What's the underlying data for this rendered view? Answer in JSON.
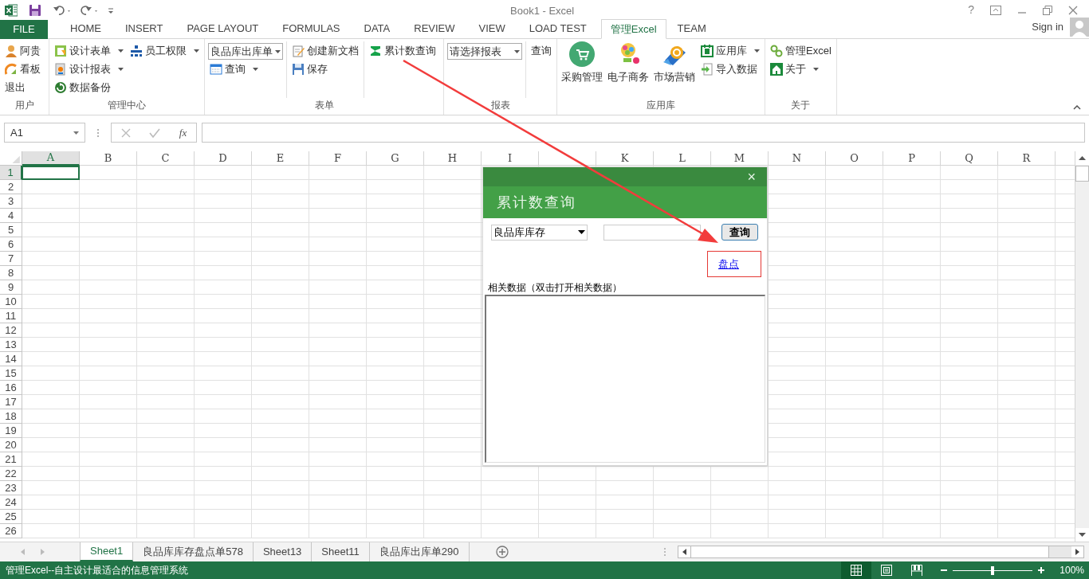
{
  "window": {
    "title": "Book1 - Excel",
    "help": "?"
  },
  "tabs": [
    {
      "label": "FILE",
      "kind": "file"
    },
    {
      "label": "HOME",
      "kind": "tab",
      "selected": false
    },
    {
      "label": "INSERT",
      "kind": "tab",
      "selected": false
    },
    {
      "label": "PAGE LAYOUT",
      "kind": "tab",
      "selected": false
    },
    {
      "label": "FORMULAS",
      "kind": "tab",
      "selected": false
    },
    {
      "label": "DATA",
      "kind": "tab",
      "selected": false
    },
    {
      "label": "REVIEW",
      "kind": "tab",
      "selected": false
    },
    {
      "label": "VIEW",
      "kind": "tab",
      "selected": false
    },
    {
      "label": "LOAD TEST",
      "kind": "tab",
      "selected": false
    },
    {
      "label": "管理Excel",
      "kind": "tab",
      "selected": true
    },
    {
      "label": "TEAM",
      "kind": "tab",
      "selected": false
    }
  ],
  "account": {
    "sign_in": "Sign in"
  },
  "ribbon": {
    "groups": [
      {
        "label": "用户",
        "columns": [
          [
            {
              "kind": "button",
              "label": "阿贵",
              "dropdown": false
            },
            {
              "kind": "button",
              "label": "看板",
              "dropdown": false
            },
            {
              "kind": "button",
              "label": "退出",
              "dropdown": false
            }
          ]
        ]
      },
      {
        "label": "管理中心",
        "columns": [
          [
            {
              "kind": "button",
              "label": "设计表单",
              "dropdown": true
            },
            {
              "kind": "button",
              "label": "设计报表",
              "dropdown": true
            },
            {
              "kind": "button",
              "label": "数据备份",
              "dropdown": false
            }
          ],
          [
            {
              "kind": "button",
              "label": "员工权限",
              "dropdown": true
            }
          ]
        ]
      },
      {
        "label": "表单",
        "columns": [
          [
            {
              "kind": "combo",
              "value": "良品库出库单"
            },
            {
              "kind": "button",
              "label": "查询",
              "dropdown": true
            }
          ],
          [
            {
              "kind": "button",
              "label": "创建新文档",
              "dropdown": false
            },
            {
              "kind": "button",
              "label": "保存",
              "dropdown": false
            }
          ],
          [
            {
              "kind": "button",
              "label": "累计数查询",
              "dropdown": false
            }
          ]
        ]
      },
      {
        "label": "报表",
        "columns": [
          [
            {
              "kind": "combo",
              "value": "请选择报表"
            }
          ],
          [
            {
              "kind": "button",
              "label": "查询",
              "dropdown": false
            }
          ]
        ]
      },
      {
        "label": "应用库",
        "columns": [
          [
            {
              "kind": "large",
              "label": "采购管理"
            }
          ],
          [
            {
              "kind": "large",
              "label": "电子商务"
            }
          ],
          [
            {
              "kind": "large",
              "label": "市场营销"
            }
          ],
          [
            {
              "kind": "button",
              "label": "应用库",
              "dropdown": true
            },
            {
              "kind": "button",
              "label": "导入数据",
              "dropdown": false
            }
          ]
        ]
      },
      {
        "label": "关于",
        "columns": [
          [
            {
              "kind": "button",
              "label": "管理Excel",
              "dropdown": false
            },
            {
              "kind": "button",
              "label": "关于",
              "dropdown": true
            }
          ]
        ]
      }
    ]
  },
  "formula_bar": {
    "name_box": "A1",
    "fx": "fx"
  },
  "sheet": {
    "columns": [
      {
        "label": "A",
        "selected": true
      },
      {
        "label": "B",
        "selected": false
      },
      {
        "label": "C",
        "selected": false
      },
      {
        "label": "D",
        "selected": false
      },
      {
        "label": "E",
        "selected": false
      },
      {
        "label": "F",
        "selected": false
      },
      {
        "label": "G",
        "selected": false
      },
      {
        "label": "H",
        "selected": false
      },
      {
        "label": "I",
        "selected": false
      },
      {
        "selected": false
      },
      {
        "label": "K",
        "selected": false
      },
      {
        "label": "L",
        "selected": false
      },
      {
        "label": "M",
        "selected": false
      },
      {
        "label": "N",
        "selected": false
      },
      {
        "label": "O",
        "selected": false
      },
      {
        "label": "P",
        "selected": false
      },
      {
        "label": "Q",
        "selected": false
      },
      {
        "label": "R",
        "selected": false
      }
    ],
    "rows": [
      {
        "label": "1",
        "selected": true
      },
      {
        "label": "2",
        "selected": false
      },
      {
        "label": "3",
        "selected": false
      },
      {
        "label": "4",
        "selected": false
      },
      {
        "label": "5",
        "selected": false
      },
      {
        "label": "6",
        "selected": false
      },
      {
        "label": "7",
        "selected": false
      },
      {
        "label": "8",
        "selected": false
      },
      {
        "label": "9",
        "selected": false
      },
      {
        "label": "10",
        "selected": false
      },
      {
        "label": "11",
        "selected": false
      },
      {
        "label": "12",
        "selected": false
      },
      {
        "label": "13",
        "selected": false
      },
      {
        "label": "14",
        "selected": false
      },
      {
        "label": "15",
        "selected": false
      },
      {
        "label": "16",
        "selected": false
      },
      {
        "label": "17",
        "selected": false
      },
      {
        "label": "18",
        "selected": false
      },
      {
        "label": "19",
        "selected": false
      },
      {
        "label": "20",
        "selected": false
      },
      {
        "label": "21",
        "selected": false
      },
      {
        "label": "22",
        "selected": false
      },
      {
        "label": "23",
        "selected": false
      },
      {
        "label": "24",
        "selected": false
      },
      {
        "label": "25",
        "selected": false
      },
      {
        "label": "26",
        "selected": false
      }
    ]
  },
  "dialog": {
    "close": "×",
    "title": "累计数查询",
    "select_value": "良品库库存",
    "query_button": "查询",
    "link": "盘点",
    "legend": "相关数据（双击打开相关数据）"
  },
  "sheet_tabs": [
    {
      "label": "Sheet1",
      "selected": true
    },
    {
      "label": "良品库库存盘点单578",
      "selected": false
    },
    {
      "label": "Sheet13",
      "selected": false
    },
    {
      "label": "Sheet11",
      "selected": false
    },
    {
      "label": "良品库出库单290",
      "selected": false
    }
  ],
  "status_bar": {
    "text": "管理Excel--自主设计最适合的信息管理系统",
    "views": [
      {
        "kind": "normal",
        "selected": true
      },
      {
        "kind": "layout",
        "selected": false
      },
      {
        "kind": "break",
        "selected": false
      }
    ],
    "zoom": {
      "level": 0.5,
      "reading": "100%"
    }
  }
}
